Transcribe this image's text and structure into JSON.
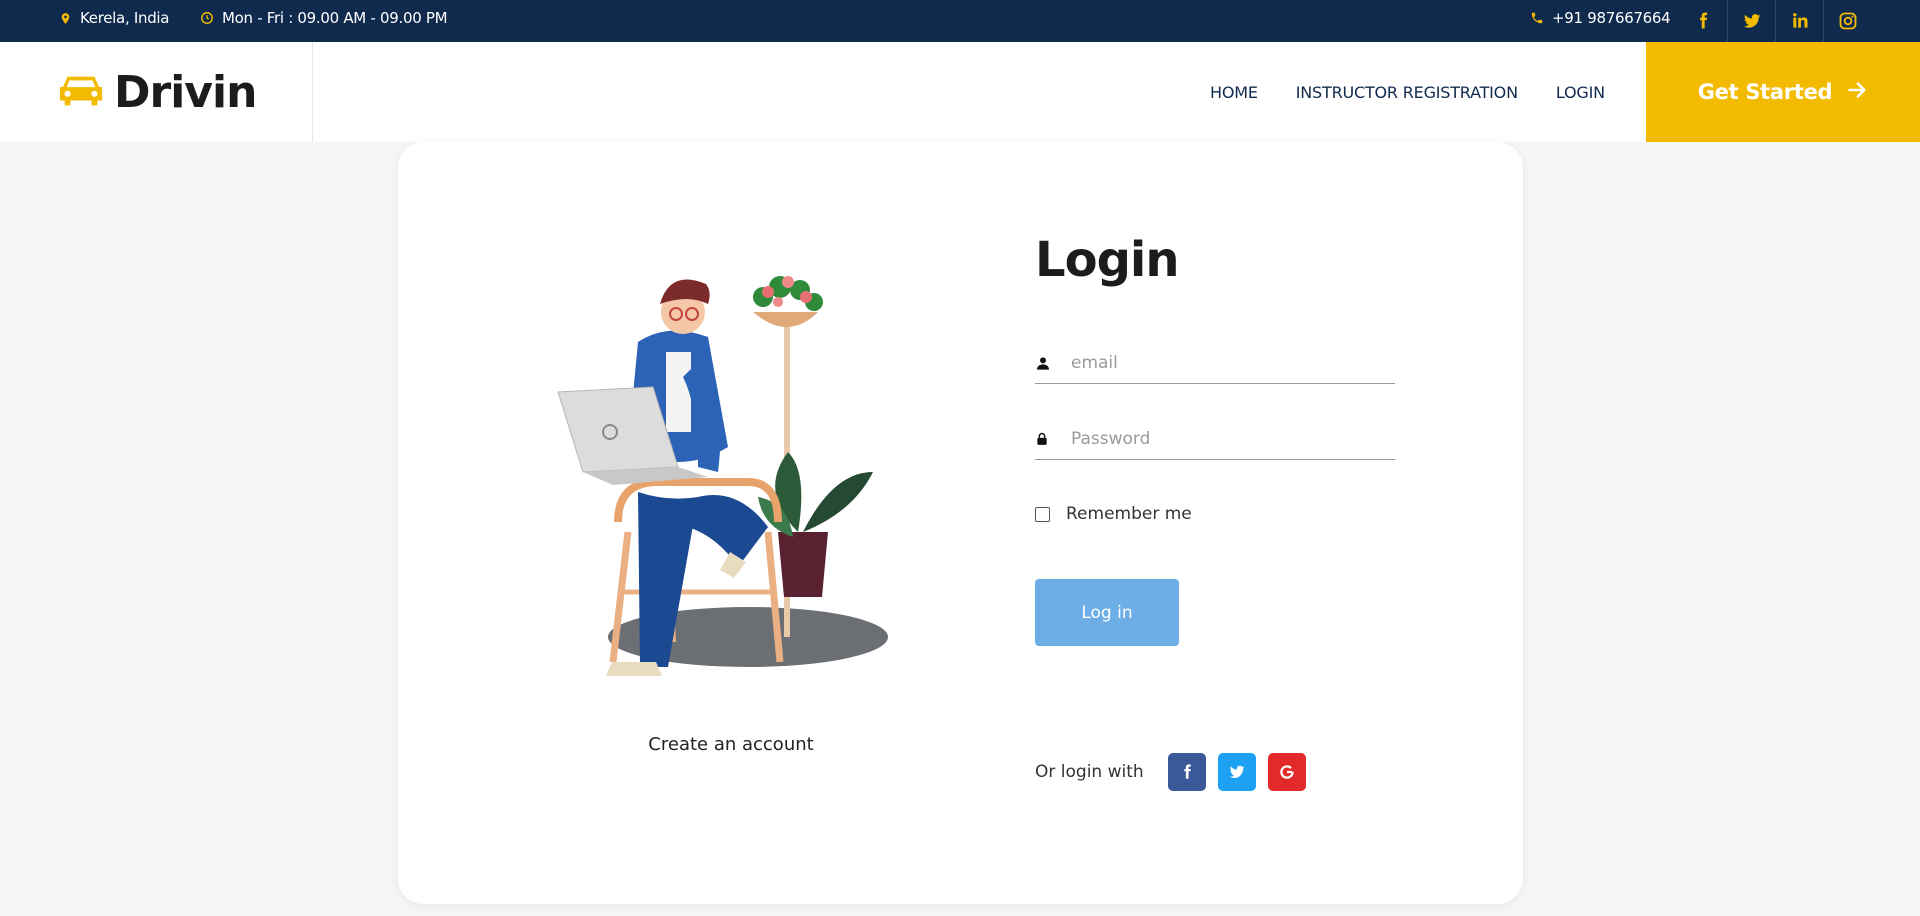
{
  "topbar": {
    "location": "Kerela, India",
    "hours": "Mon - Fri : 09.00 AM - 09.00 PM",
    "phone": "+91 987667664",
    "socials": [
      "facebook-icon",
      "twitter-icon",
      "linkedin-icon",
      "instagram-icon"
    ]
  },
  "navbar": {
    "brand": "Drivin",
    "links": [
      "HOME",
      "INSTRUCTOR REGISTRATION",
      "LOGIN"
    ],
    "cta": "Get Started"
  },
  "login": {
    "title": "Login",
    "email_placeholder": "email",
    "password_placeholder": "Password",
    "remember_label": "Remember me",
    "button_label": "Log in",
    "or_login_with": "Or login with",
    "create_account": "Create an account",
    "social_buttons": [
      "facebook",
      "twitter",
      "google"
    ]
  },
  "colors": {
    "topbar_bg": "#0f2a4d",
    "accent": "#f3bb00",
    "login_button": "#6eaee6",
    "facebook": "#3b5998",
    "twitter": "#1da1f2",
    "google": "#e32a2a"
  }
}
